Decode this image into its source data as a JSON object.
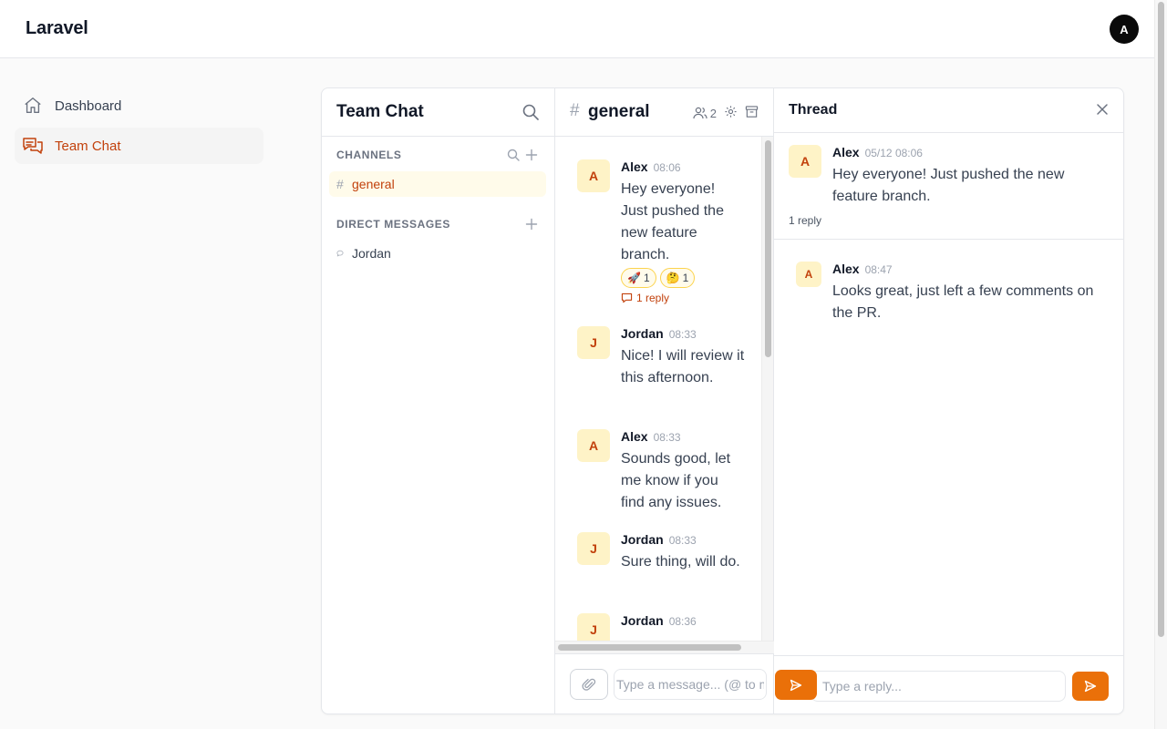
{
  "app": {
    "brand": "Laravel",
    "user_initial": "A",
    "accent": "#ea7009",
    "accent_text": "#c2410c"
  },
  "nav": {
    "items": [
      {
        "label": "Dashboard",
        "icon": "home-icon",
        "active": false
      },
      {
        "label": "Team Chat",
        "icon": "chat-bubbles-icon",
        "active": true
      }
    ]
  },
  "channels_panel": {
    "title": "Team Chat",
    "channels_label": "CHANNELS",
    "channels": [
      {
        "prefix": "#",
        "name": "general",
        "active": true
      }
    ],
    "dm_label": "DIRECT MESSAGES",
    "dms": [
      {
        "name": "Jordan"
      }
    ]
  },
  "channel": {
    "hash": "#",
    "name": "general",
    "member_count": "2",
    "messages": [
      {
        "initial": "A",
        "author": "Alex",
        "time": "08:06",
        "text": "Hey everyone! Just pushed the new feature branch.",
        "reactions": [
          {
            "emoji": "🚀",
            "count": "1"
          },
          {
            "emoji": "🤔",
            "count": "1"
          }
        ],
        "reply_label": "1 reply"
      },
      {
        "initial": "J",
        "author": "Jordan",
        "time": "08:33",
        "text": "Nice! I will review it this afternoon."
      },
      {
        "initial": "A",
        "author": "Alex",
        "time": "08:33",
        "text": "Sounds good, let me know if you find any issues."
      },
      {
        "initial": "J",
        "author": "Jordan",
        "time": "08:33",
        "text": "Sure thing, will do."
      },
      {
        "initial": "J",
        "author": "Jordan",
        "time": "08:36",
        "text": ""
      }
    ],
    "composer": {
      "placeholder": "Type a message... (@ to mention)"
    }
  },
  "thread": {
    "title": "Thread",
    "parent": {
      "initial": "A",
      "author": "Alex",
      "time": "05/12 08:06",
      "text": "Hey everyone! Just pushed the new feature branch.",
      "reply_count": "1 reply"
    },
    "replies": [
      {
        "initial": "A",
        "author": "Alex",
        "time": "08:47",
        "text": "Looks great, just left a few comments on the PR."
      }
    ],
    "composer": {
      "placeholder": "Type a reply..."
    }
  }
}
